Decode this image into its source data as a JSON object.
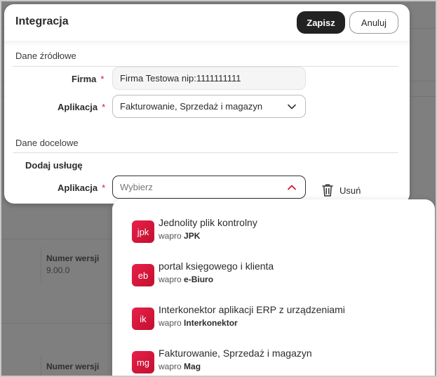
{
  "background": {
    "rows": [
      {
        "label": "Numer wersji",
        "value": "9.00.0"
      },
      {
        "label": "Numer wersji",
        "value": ""
      }
    ]
  },
  "modal": {
    "title": "Integracja",
    "save_label": "Zapisz",
    "cancel_label": "Anuluj",
    "source_section": "Dane źródłowe",
    "firma_label": "Firma",
    "firma_value": "Firma Testowa nip:1111111111",
    "aplikacja_label": "Aplikacja",
    "aplikacja_value": "Fakturowanie, Sprzedaż i magazyn",
    "target_section": "Dane docelowe",
    "add_service_label": "Dodaj usługę",
    "target_aplikacja_label": "Aplikacja",
    "target_placeholder": "Wybierz",
    "remove_label": "Usuń",
    "required_mark": "*"
  },
  "dropdown": {
    "options": [
      {
        "icon_text": "jpk",
        "title": "Jednolity plik kontrolny",
        "prefix": "wapro",
        "code": "JPK"
      },
      {
        "icon_text": "eb",
        "title": "portal księgowego i klienta",
        "prefix": "wapro",
        "code": "e-Biuro"
      },
      {
        "icon_text": "ik",
        "title": "Interkonektor aplikacji ERP z urządzeniami",
        "prefix": "wapro",
        "code": "Interkonektor"
      },
      {
        "icon_text": "mg",
        "title": "Fakturowanie, Sprzedaż i magazyn",
        "prefix": "wapro",
        "code": "Mag"
      }
    ]
  },
  "colors": {
    "accent_red": "#d1143c",
    "primary_button": "#222222"
  }
}
